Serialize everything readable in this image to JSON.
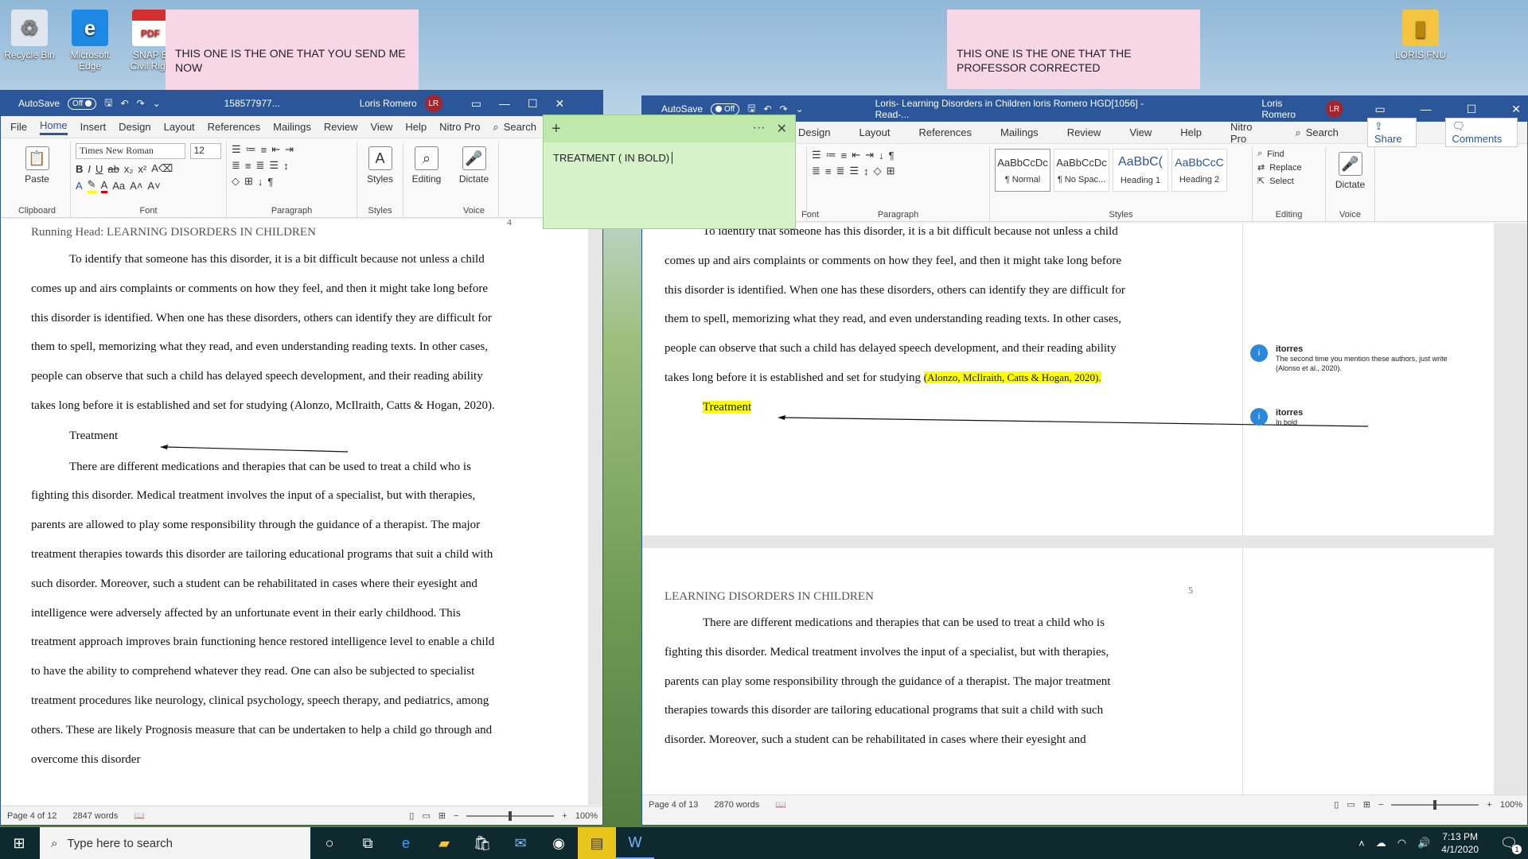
{
  "desktop": {
    "icons": [
      {
        "label": "Recycle Bin",
        "icon": "recycle-bin-icon"
      },
      {
        "label": "Microsoft Edge",
        "icon": "edge-icon"
      },
      {
        "label": "SNAP E Civil Righ",
        "icon": "pdf-icon",
        "glyph": "PDF"
      },
      {
        "label": "LORIS FNU",
        "icon": "folder-icon"
      }
    ]
  },
  "sticky_notes": {
    "left": "THIS ONE IS THE ONE THAT YOU SEND ME NOW",
    "right": "THIS ONE IS THE ONE THAT THE PROFESSOR CORRECTED",
    "green": "TREATMENT ( IN BOLD)"
  },
  "word_left": {
    "autosave_label": "AutoSave",
    "autosave_state": "Off",
    "title": "158577977...",
    "user": "Loris Romero",
    "user_initials": "LR",
    "tabs": [
      "File",
      "Home",
      "Insert",
      "Design",
      "Layout",
      "References",
      "Mailings",
      "Review",
      "View",
      "Help",
      "Nitro Pro"
    ],
    "search_label": "Search",
    "font_name": "Times New Roman",
    "font_size": "12",
    "groups": {
      "clipboard": "Clipboard",
      "font": "Font",
      "paragraph": "Paragraph",
      "styles": "Styles",
      "voice": "Voice"
    },
    "buttons": {
      "paste": "Paste",
      "styles": "Styles",
      "editing": "Editing",
      "dictate": "Dictate"
    },
    "page_number": "4",
    "running_head": "Running Head: LEARNING DISORDERS IN CHILDREN",
    "para1_lines": [
      "To identify that someone has this disorder, it is a bit difficult because not unless a child",
      "comes up and airs complaints or comments on how they feel, and then it might take long before",
      "this disorder is identified. When one has these disorders, others can identify they are difficult for",
      "them to spell, memorizing what they read, and even understanding reading texts. In other cases,",
      "people can observe that such a child has delayed speech development, and their reading ability",
      "takes long before it is established and set for studying (Alonzo, McIlraith, Catts & Hogan, 2020)."
    ],
    "heading": "Treatment",
    "para2_lines": [
      "There are different medications and therapies that can be used to treat a child who is",
      "fighting this disorder. Medical treatment involves the input of a specialist, but with therapies,",
      "parents are allowed to play some responsibility through the guidance of a therapist. The major",
      "treatment therapies towards this disorder are tailoring educational programs that suit a child with",
      "such disorder. Moreover, such a student can be rehabilitated in cases where their eyesight and",
      "intelligence were adversely affected by an unfortunate event in their early childhood. This",
      "treatment approach improves brain functioning hence restored intelligence level to enable a child",
      "to have the ability to comprehend whatever they read. One can also be subjected to specialist",
      "treatment procedures like neurology, clinical psychology, speech therapy, and pediatrics, among",
      "others. These are likely Prognosis measure that can be undertaken to help a child go through and",
      "overcome this disorder"
    ],
    "status": {
      "page": "Page 4 of 12",
      "words": "2847 words",
      "zoom": "100%"
    },
    "zoom_fraction": 0.5
  },
  "word_right": {
    "autosave_label": "AutoSave",
    "autosave_state": "Off",
    "title": "Loris- Learning Disorders in Children loris Romero HGD[1056]  -  Read-...",
    "user": "Loris Romero",
    "user_initials": "LR",
    "tabs": [
      "Design",
      "Layout",
      "References",
      "Mailings",
      "Review",
      "View",
      "Help",
      "Nitro Pro"
    ],
    "search_label": "Search",
    "share_label": "Share",
    "comments_label": "Comments",
    "styles": [
      {
        "preview": "AaBbCcDc",
        "name": "¶ Normal"
      },
      {
        "preview": "AaBbCcDc",
        "name": "¶ No Spac..."
      },
      {
        "preview": "AaBbC(",
        "name": "Heading 1"
      },
      {
        "preview": "AaBbCcC",
        "name": "Heading 2"
      }
    ],
    "editing": {
      "find": "Find",
      "replace": "Replace",
      "select": "Select"
    },
    "groups": {
      "font": "Font",
      "paragraph": "Paragraph",
      "styles": "Styles",
      "editing": "Editing",
      "voice": "Voice"
    },
    "dictate": "Dictate",
    "para1_lines": [
      "To identify that someone has this disorder, it is a bit difficult because not unless a child",
      "comes up and airs complaints or comments on how they feel, and then it might take long before",
      "this disorder is identified. When one has these disorders, others can identify they are difficult for",
      "them to spell, memorizing what they read, and even understanding reading texts. In other cases,",
      "people can observe that such a child has delayed speech development, and their reading ability"
    ],
    "para1_last_prefix": "takes long before it is established and set for studying ",
    "citation": "(Alonzo, McIlraith, Catts & Hogan, 2020).",
    "heading": "Treatment",
    "comments": [
      {
        "author": "itorres",
        "initial": "i",
        "text": "The second time you mention these authors, just write (Alonso et al., 2020)."
      },
      {
        "author": "itorres",
        "initial": "i",
        "text": "In bold"
      }
    ],
    "page5_number": "5",
    "page5_head": "LEARNING DISORDERS IN CHILDREN",
    "para2_lines": [
      "There are different medications and therapies that can be used to treat a child who is",
      "fighting this disorder. Medical treatment involves the input of a specialist, but with therapies,",
      "parents can play some responsibility through the guidance of a therapist. The major treatment",
      "therapies towards this disorder are tailoring educational programs that suit a child with such",
      "disorder. Moreover, such a student can be rehabilitated in cases where their eyesight and"
    ],
    "status": {
      "page": "Page 4 of 13",
      "words": "2870 words",
      "zoom": "100%"
    },
    "zoom_fraction": 0.5
  },
  "taskbar": {
    "search_placeholder": "Type here to search",
    "time": "7:13 PM",
    "date": "4/1/2020",
    "notification_count": "1"
  }
}
